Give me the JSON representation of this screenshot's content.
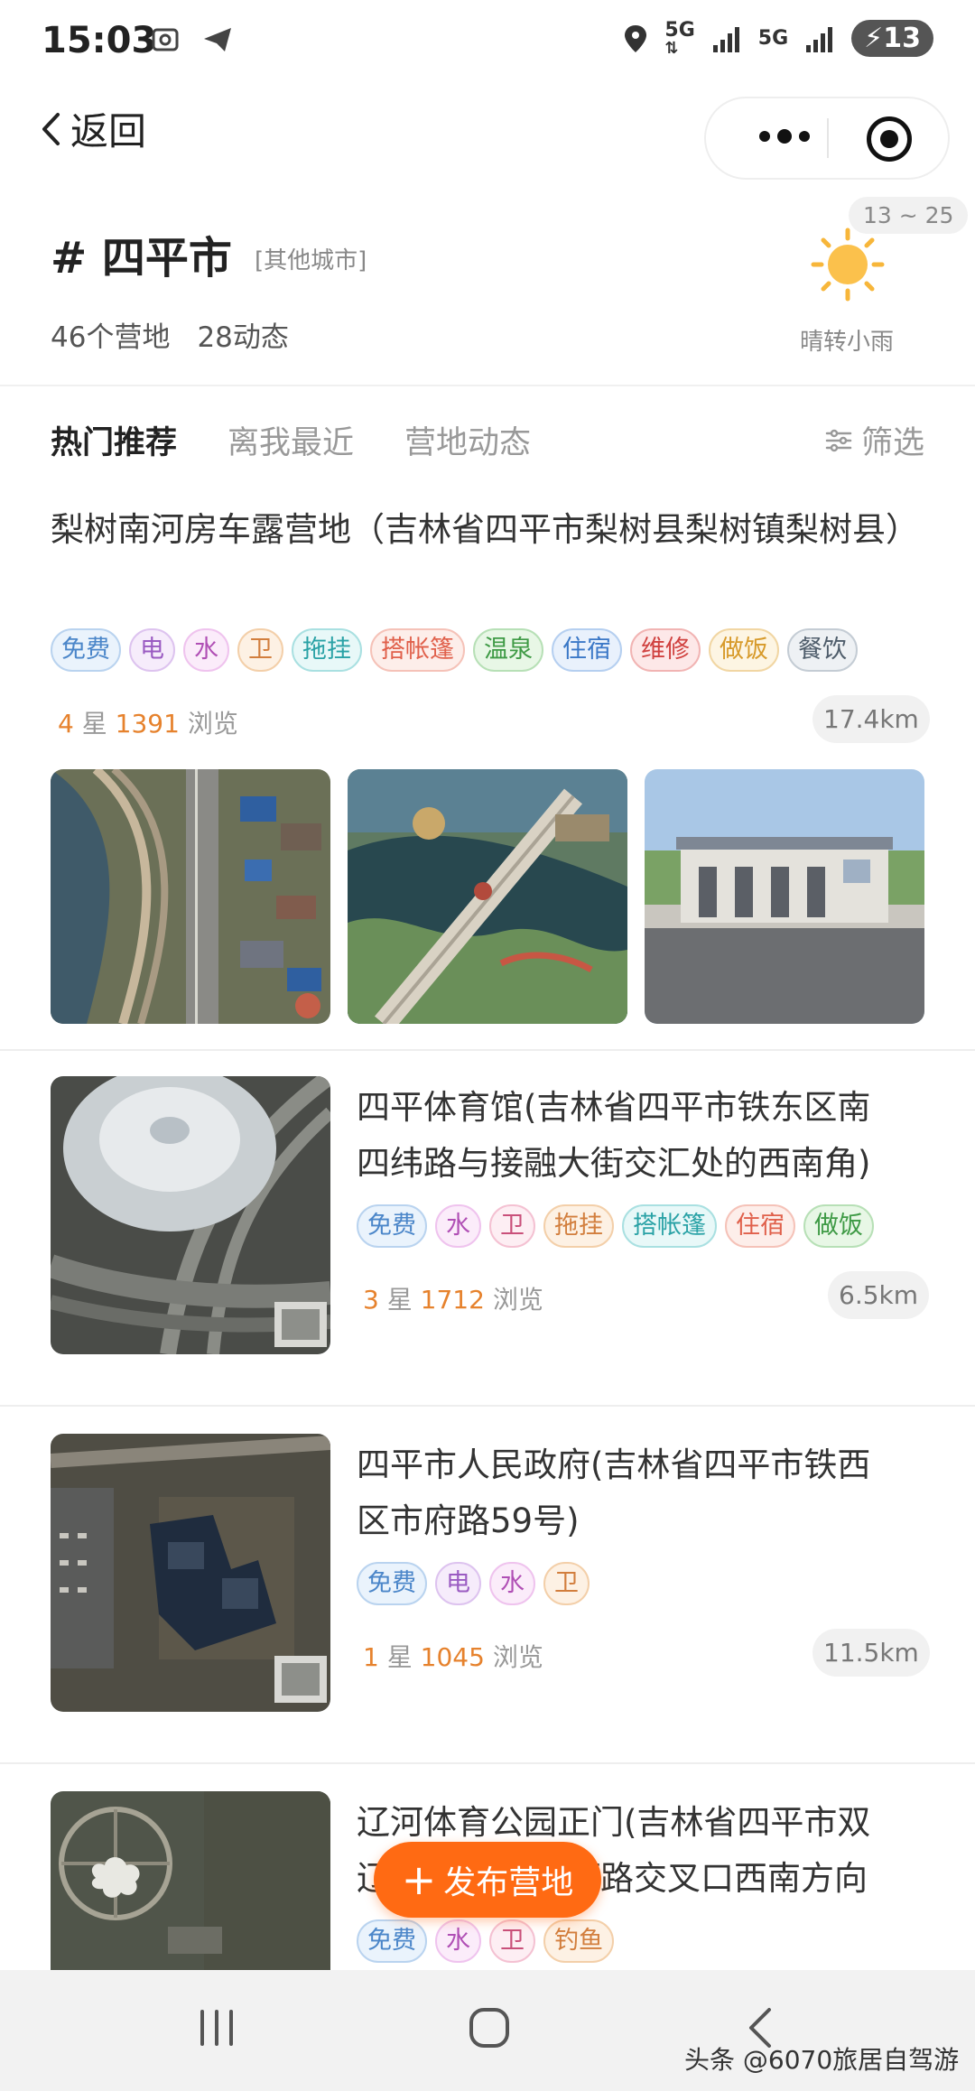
{
  "status_bar": {
    "time": "15:03",
    "network_1": "5G",
    "network_2": "5G",
    "battery": "13"
  },
  "nav": {
    "back_label": "返回"
  },
  "header": {
    "city": "# 四平市",
    "city_tag": "[其他城市]",
    "camps_count": "46个营地",
    "posts_count": "28动态",
    "temp_range": "13 ~ 25",
    "weather": "晴转小雨"
  },
  "tabs": [
    {
      "label": "热门推荐",
      "active": true
    },
    {
      "label": "离我最近",
      "active": false
    },
    {
      "label": "营地动态",
      "active": false
    }
  ],
  "filter_label": "筛选",
  "items": [
    {
      "title": "梨树南河房车露营地（吉林省四平市梨树县梨树镇梨树县）",
      "tags": [
        "免费",
        "电",
        "水",
        "卫",
        "拖挂",
        "搭帐篷",
        "温泉",
        "住宿",
        "维修",
        "做饭",
        "餐饮"
      ],
      "stars": "4",
      "star_label": "星",
      "views": "1391",
      "views_label": "浏览",
      "distance": "17.4km"
    },
    {
      "title_line1": "四平体育馆(吉林省四平市铁东区南",
      "title_line2": "四纬路与接融大街交汇处的西南角)",
      "tags": [
        "免费",
        "水",
        "卫",
        "拖挂",
        "搭帐篷",
        "住宿",
        "做饭"
      ],
      "stars": "3",
      "star_label": "星",
      "views": "1712",
      "views_label": "浏览",
      "distance": "6.5km"
    },
    {
      "title_line1": "四平市人民政府(吉林省四平市铁西",
      "title_line2": "区市府路59号)",
      "tags": [
        "免费",
        "电",
        "水",
        "卫"
      ],
      "stars": "1",
      "star_label": "星",
      "views": "1045",
      "views_label": "浏览",
      "distance": "11.5km"
    },
    {
      "title_line1": "辽河体育公园正门(吉林省四平市双",
      "title_line2_left": "辽",
      "title_line2_right": "河路交叉口西南方向",
      "tags": [
        "免费",
        "水",
        "卫",
        "钓鱼"
      ]
    }
  ],
  "fab_label": "发布营地",
  "watermark": "头条 @6070旅居自驾游",
  "colors": {
    "accent": "#ff6a13",
    "star_highlight": "#e6822d"
  }
}
